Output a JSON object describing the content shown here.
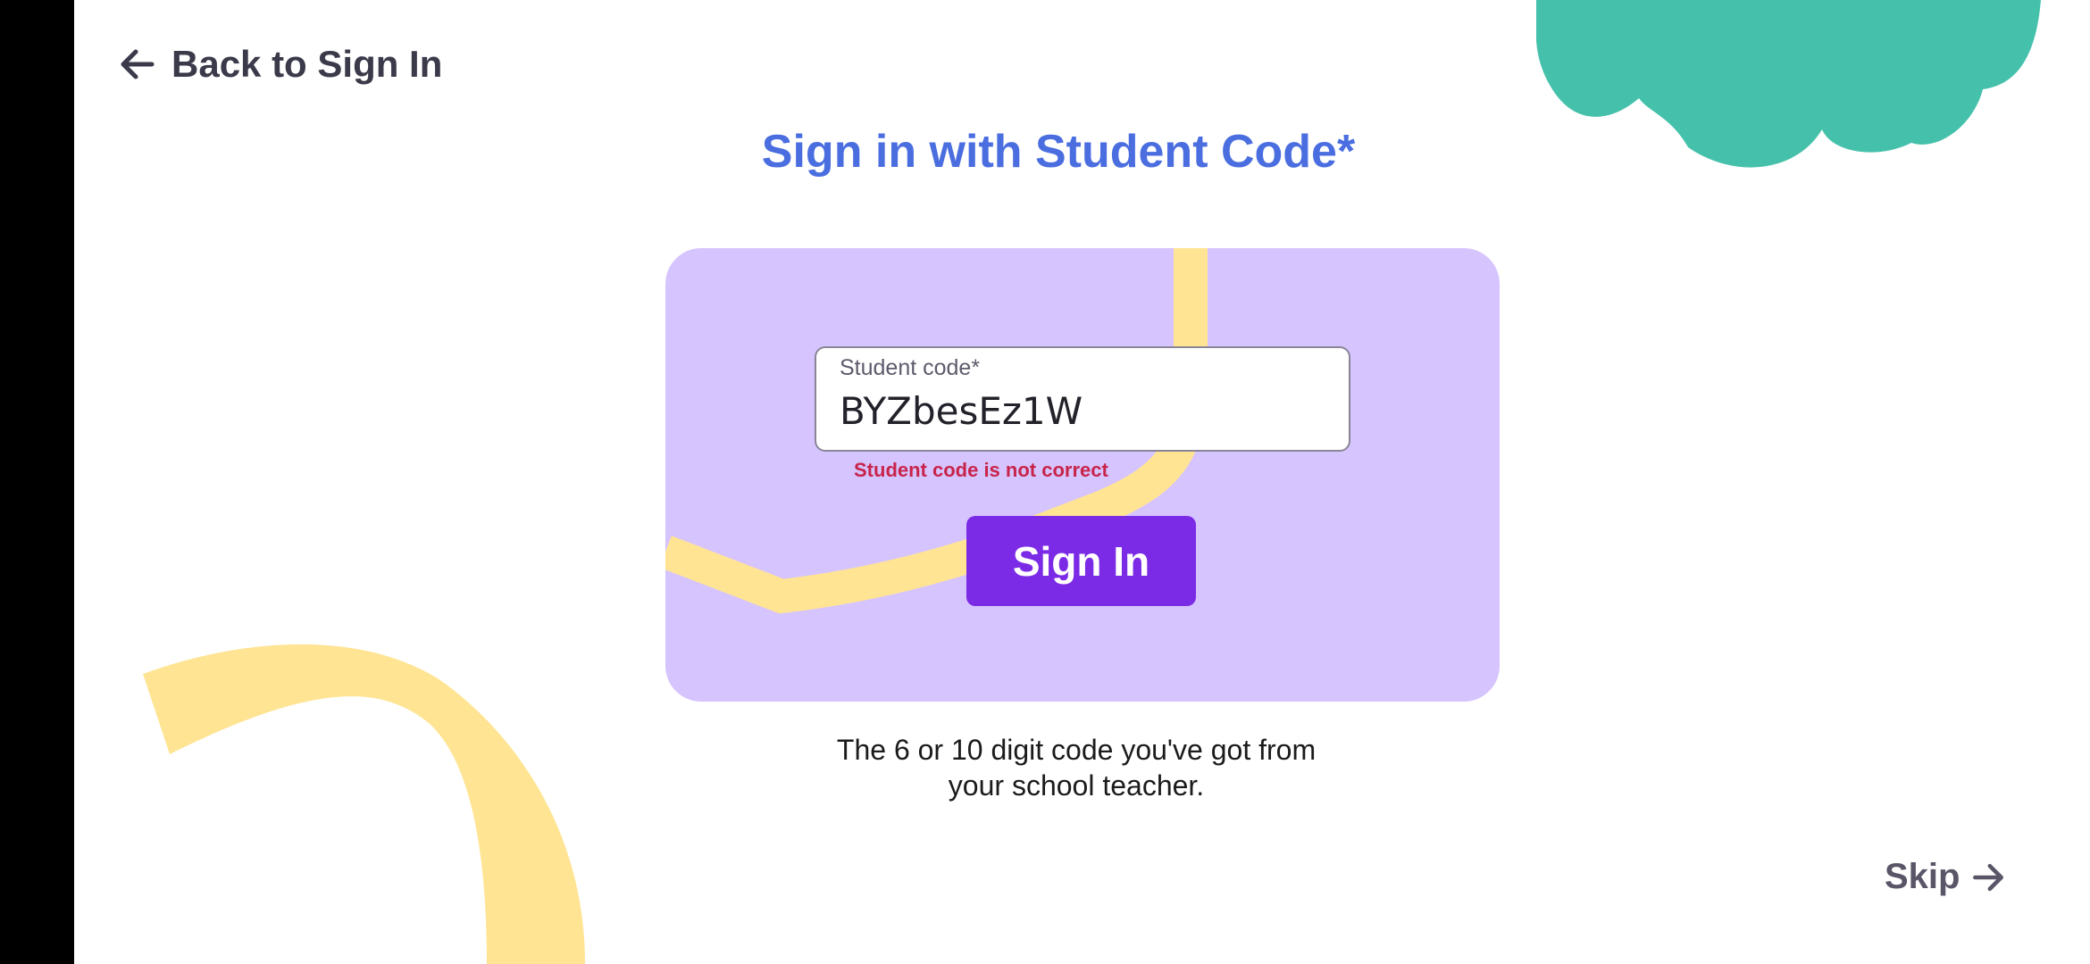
{
  "nav": {
    "back_label": "Back to Sign In",
    "skip_label": "Skip"
  },
  "page": {
    "title": "Sign in with Student Code*"
  },
  "form": {
    "code_label": "Student code*",
    "code_value": "BYZbesEz1W",
    "error": "Student code is not correct",
    "submit_label": "Sign In"
  },
  "hint": {
    "line1": "The 6 or 10 digit code you've got from",
    "line2": "your school teacher."
  },
  "colors": {
    "title": "#4a6ee0",
    "card": "#d6c4ff",
    "button": "#7b2be6",
    "error": "#c8244a",
    "teal_blob": "#45c1ab",
    "yellow_path": "#ffe493"
  },
  "icons": {
    "back": "arrow-left-icon",
    "skip": "arrow-right-icon"
  }
}
